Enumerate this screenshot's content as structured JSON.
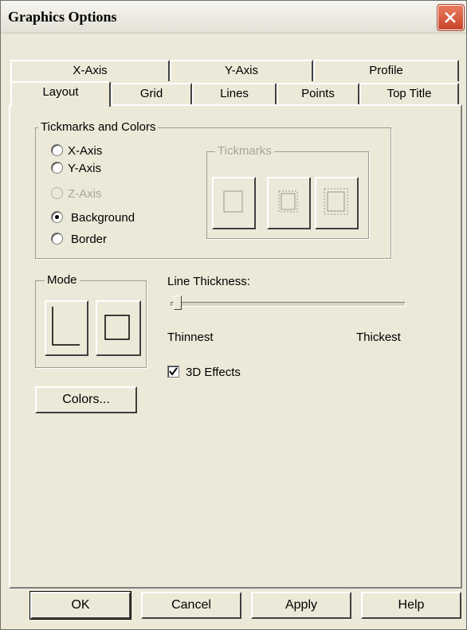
{
  "window": {
    "title": "Graphics Options",
    "close_icon": "close-icon"
  },
  "tabs_back": [
    {
      "label": "X-Axis"
    },
    {
      "label": "Y-Axis"
    },
    {
      "label": "Profile"
    }
  ],
  "tabs_front": [
    {
      "label": "Layout",
      "active": true
    },
    {
      "label": "Grid"
    },
    {
      "label": "Lines"
    },
    {
      "label": "Points"
    },
    {
      "label": "Top Title"
    }
  ],
  "tickmarks_colors": {
    "group_label": "Tickmarks and Colors",
    "options": [
      {
        "label": "X-Axis",
        "selected": false,
        "enabled": true
      },
      {
        "label": "Y-Axis",
        "selected": false,
        "enabled": true
      },
      {
        "label": "Z-Axis",
        "selected": false,
        "enabled": false
      },
      {
        "label": "Background",
        "selected": true,
        "enabled": true
      },
      {
        "label": "Border",
        "selected": false,
        "enabled": true
      }
    ],
    "tickmarks_group_label": "Tickmarks"
  },
  "mode": {
    "group_label": "Mode"
  },
  "line_thickness": {
    "label": "Line Thickness:",
    "min_label": "Thinnest",
    "max_label": "Thickest",
    "value_fraction": 0.0
  },
  "effects": {
    "label": "3D Effects",
    "checked": true
  },
  "colors_button": "Colors...",
  "footer": {
    "ok": "OK",
    "cancel": "Cancel",
    "apply": "Apply",
    "help": "Help"
  }
}
